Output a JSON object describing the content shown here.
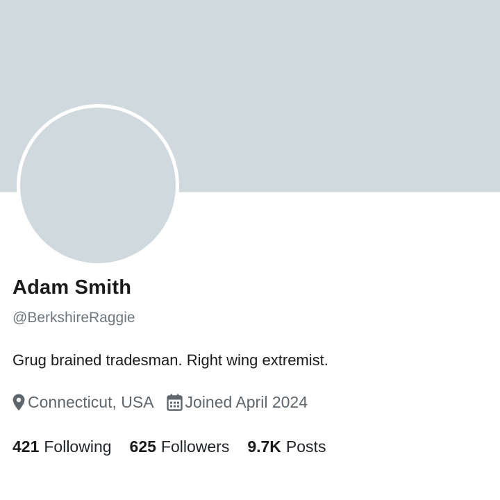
{
  "profile": {
    "name": "Adam Smith",
    "handle": "@BerkshireRaggie",
    "bio": "Grug brained tradesman. Right wing extremist.",
    "location": "Connecticut, USA",
    "joined": "Joined April 2024"
  },
  "stats": {
    "following_count": "421",
    "following_label": "Following",
    "followers_count": "625",
    "followers_label": "Followers",
    "posts_count": "9.7K",
    "posts_label": "Posts"
  },
  "icons": {
    "location": "map-pin-icon",
    "joined": "calendar-icon"
  },
  "colors": {
    "banner": "#cfd9de",
    "avatar_placeholder": "#cfd9de",
    "text_primary": "#1a1a1a",
    "text_secondary": "#6e767d"
  }
}
